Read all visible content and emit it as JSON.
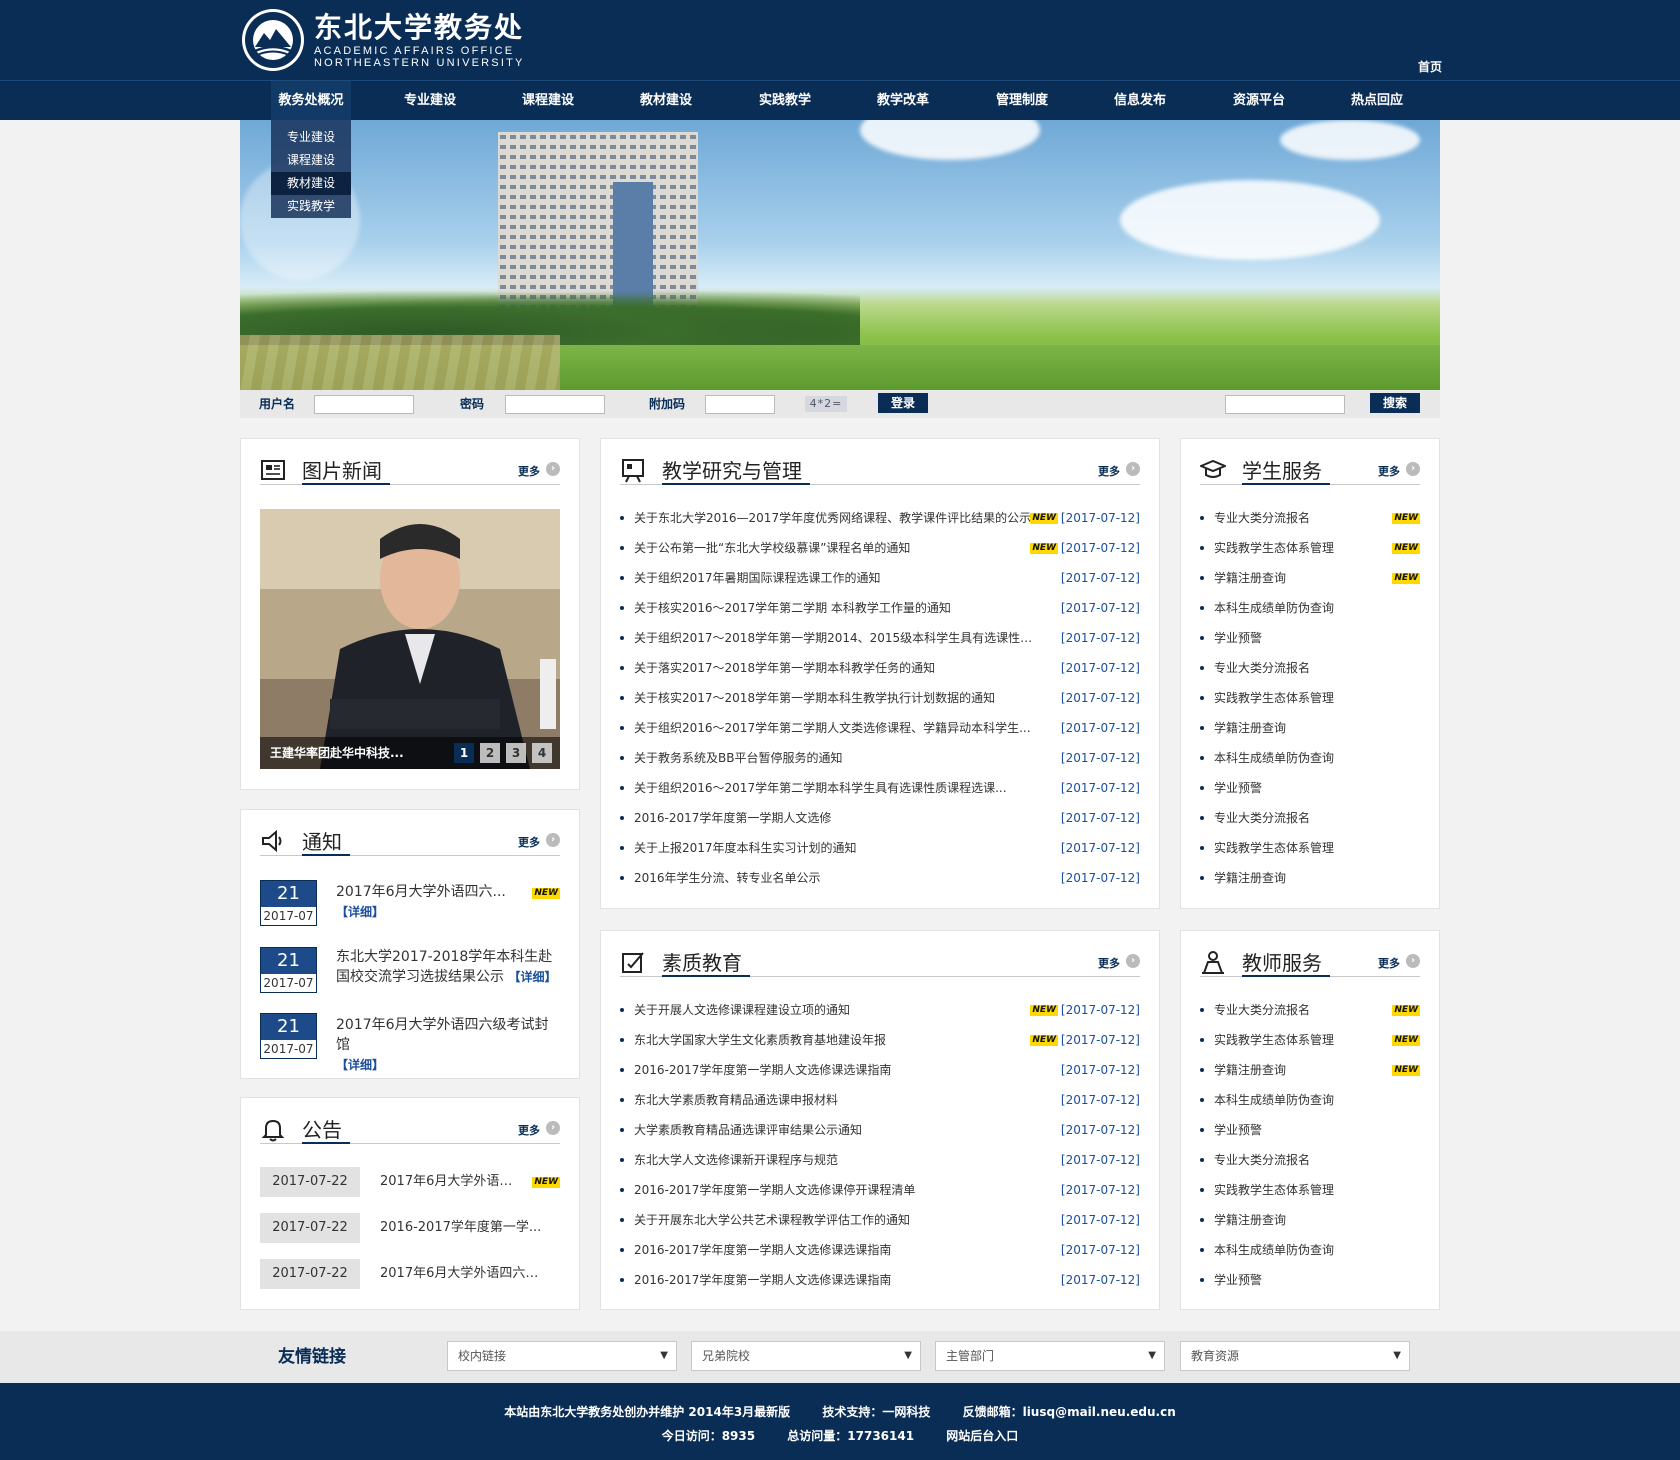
{
  "header": {
    "title_cn": "东北大学教务处",
    "title_en_1": "ACADEMIC   AFFAIRS   OFFICE",
    "title_en_2": "NORTHEASTERN   UNIVERSITY",
    "home": "首页"
  },
  "nav": {
    "items": [
      "教务处概况",
      "专业建设",
      "课程建设",
      "教材建设",
      "实践教学",
      "教学改革",
      "管理制度",
      "信息发布",
      "资源平台",
      "热点回应"
    ],
    "dropdown": [
      "专业建设",
      "课程建设",
      "教材建设",
      "实践教学"
    ]
  },
  "login": {
    "username_label": "用户名",
    "password_label": "密码",
    "captcha_label": "附加码",
    "captcha_text": "4*2=",
    "login_button": "登录",
    "search_button": "搜索"
  },
  "more_label": "更多",
  "new_label": "NEW",
  "photo_news": {
    "title": "图片新闻",
    "caption": "王建华率团赴华中科技...",
    "pages": [
      "1",
      "2",
      "3",
      "4"
    ]
  },
  "notice": {
    "title": "通知",
    "detail_label": "【详细】",
    "items": [
      {
        "day": "21",
        "ym": "2017-07",
        "text": "2017年6月大学外语四六...",
        "new": true
      },
      {
        "day": "21",
        "ym": "2017-07",
        "text": "东北大学2017-2018学年本科生赴国校交流学习选拔结果公示",
        "new": false
      },
      {
        "day": "21",
        "ym": "2017-07",
        "text": "2017年6月大学外语四六级考试封馆",
        "new": false
      }
    ]
  },
  "announcement": {
    "title": "公告",
    "items": [
      {
        "date": "2017-07-22",
        "text": "2017年6月大学外语四六...",
        "new": true
      },
      {
        "date": "2017-07-22",
        "text": "2016-2017学年度第一学...",
        "new": false
      },
      {
        "date": "2017-07-22",
        "text": "2017年6月大学外语四六级...",
        "new": false
      }
    ]
  },
  "teaching": {
    "title": "教学研究与管理",
    "items": [
      {
        "text": "关于东北大学2016—2017学年度优秀网络课程、教学课件评比结果的公示",
        "date": "[2017-07-12]",
        "new": true
      },
      {
        "text": "关于公布第一批“东北大学校级慕课”课程名单的通知",
        "date": "[2017-07-12]",
        "new": true
      },
      {
        "text": "关于组织2017年暑期国际课程选课工作的通知",
        "date": "[2017-07-12]",
        "new": false
      },
      {
        "text": "关于核实2016～2017学年第二学期 本科教学工作量的通知",
        "date": "[2017-07-12]",
        "new": false
      },
      {
        "text": "关于组织2017～2018学年第一学期2014、2015级本科学生具有选课性质...",
        "date": "[2017-07-12]",
        "new": false
      },
      {
        "text": "关于落实2017～2018学年第一学期本科教学任务的通知",
        "date": "[2017-07-12]",
        "new": false
      },
      {
        "text": "关于核实2017～2018学年第一学期本科生教学执行计划数据的通知",
        "date": "[2017-07-12]",
        "new": false
      },
      {
        "text": "关于组织2016～2017学年第二学期人文类选修课程、学籍异动本科学生...",
        "date": "[2017-07-12]",
        "new": false
      },
      {
        "text": "关于教务系统及BB平台暂停服务的通知",
        "date": "[2017-07-12]",
        "new": false
      },
      {
        "text": "关于组织2016～2017学年第二学期本科学生具有选课性质课程选课...",
        "date": "[2017-07-12]",
        "new": false
      },
      {
        "text": "2016-2017学年度第一学期人文选修",
        "date": "[2017-07-12]",
        "new": false
      },
      {
        "text": "关于上报2017年度本科生实习计划的通知",
        "date": "[2017-07-12]",
        "new": false
      },
      {
        "text": "2016年学生分流、转专业名单公示",
        "date": "[2017-07-12]",
        "new": false
      }
    ]
  },
  "quality": {
    "title": "素质教育",
    "items": [
      {
        "text": "关于开展人文选修课课程建设立项的通知",
        "date": "[2017-07-12]",
        "new": true
      },
      {
        "text": "东北大学国家大学生文化素质教育基地建设年报",
        "date": "[2017-07-12]",
        "new": true
      },
      {
        "text": "2016-2017学年度第一学期人文选修课选课指南",
        "date": "[2017-07-12]",
        "new": false
      },
      {
        "text": "东北大学素质教育精品通选课申报材料",
        "date": "[2017-07-12]",
        "new": false
      },
      {
        "text": "大学素质教育精品通选课评审结果公示通知",
        "date": "[2017-07-12]",
        "new": false
      },
      {
        "text": "东北大学人文选修课新开课程序与规范",
        "date": "[2017-07-12]",
        "new": false
      },
      {
        "text": "2016-2017学年度第一学期人文选修课停开课程清单",
        "date": "[2017-07-12]",
        "new": false
      },
      {
        "text": "关于开展东北大学公共艺术课程教学评估工作的通知",
        "date": "[2017-07-12]",
        "new": false
      },
      {
        "text": "2016-2017学年度第一学期人文选修课选课指南",
        "date": "[2017-07-12]",
        "new": false
      },
      {
        "text": "2016-2017学年度第一学期人文选修课选课指南",
        "date": "[2017-07-12]",
        "new": false
      }
    ]
  },
  "student": {
    "title": "学生服务",
    "items": [
      {
        "text": "专业大类分流报名",
        "new": true
      },
      {
        "text": "实践教学生态体系管理",
        "new": true
      },
      {
        "text": "学籍注册查询",
        "new": true
      },
      {
        "text": "本科生成绩单防伪查询",
        "new": false
      },
      {
        "text": "学业预警",
        "new": false
      },
      {
        "text": "专业大类分流报名",
        "new": false
      },
      {
        "text": "实践教学生态体系管理",
        "new": false
      },
      {
        "text": "学籍注册查询",
        "new": false
      },
      {
        "text": "本科生成绩单防伪查询",
        "new": false
      },
      {
        "text": "学业预警",
        "new": false
      },
      {
        "text": "专业大类分流报名",
        "new": false
      },
      {
        "text": "实践教学生态体系管理",
        "new": false
      },
      {
        "text": "学籍注册查询",
        "new": false
      }
    ]
  },
  "teacher": {
    "title": "教师服务",
    "items": [
      {
        "text": "专业大类分流报名",
        "new": true
      },
      {
        "text": "实践教学生态体系管理",
        "new": true
      },
      {
        "text": "学籍注册查询",
        "new": true
      },
      {
        "text": "本科生成绩单防伪查询",
        "new": false
      },
      {
        "text": "学业预警",
        "new": false
      },
      {
        "text": "专业大类分流报名",
        "new": false
      },
      {
        "text": "实践教学生态体系管理",
        "new": false
      },
      {
        "text": "学籍注册查询",
        "new": false
      },
      {
        "text": "本科生成绩单防伪查询",
        "new": false
      },
      {
        "text": "学业预警",
        "new": false
      }
    ]
  },
  "links": {
    "title": "友情链接",
    "selects": [
      "校内链接",
      "兄弟院校",
      "主管部门",
      "教育资源"
    ]
  },
  "footer": {
    "line1a": "本站由东北大学教务处创办并维护 2014年3月最新版",
    "line1b": "技术支持：一网科技",
    "line1c": "反馈邮箱：liusq@mail.neu.edu.cn",
    "line2a": "今日访问：8935",
    "line2b": "总访问量：17736141",
    "line2c": "网站后台入口"
  },
  "colors": {
    "brand": "#0a2d56",
    "date_link": "#1a4f9a",
    "new_badge": "#ffd800"
  }
}
